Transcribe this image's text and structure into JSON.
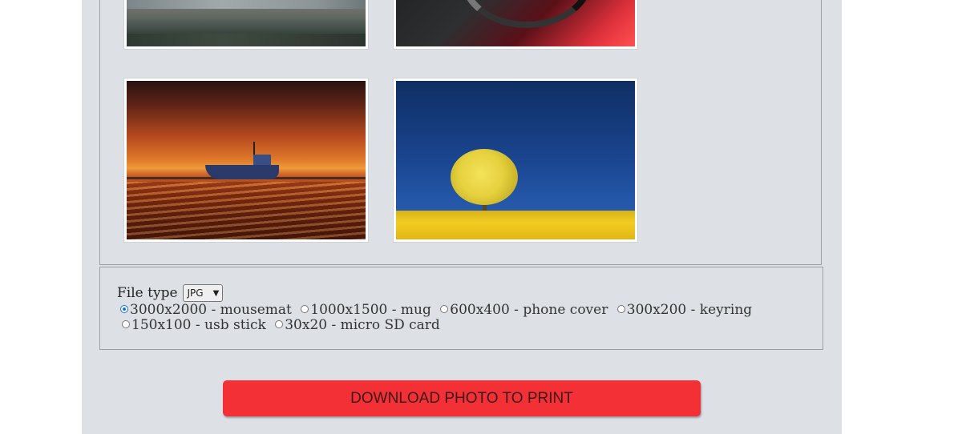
{
  "gallery": {
    "photos": [
      {
        "icon": "coast-photo"
      },
      {
        "icon": "red-car-photo"
      },
      {
        "icon": "boat-sunset-photo"
      },
      {
        "icon": "yellow-tree-photo"
      }
    ]
  },
  "options": {
    "file_type_label": "File type",
    "file_type_value": "JPG",
    "sizes": [
      {
        "label": "3000x2000 - mousemat",
        "checked": true
      },
      {
        "label": "1000x1500 - mug",
        "checked": false
      },
      {
        "label": "600x400 - phone cover",
        "checked": false
      },
      {
        "label": "300x200 - keyring",
        "checked": false
      },
      {
        "label": "150x100 - usb stick",
        "checked": false
      },
      {
        "label": "30x20 - micro SD card",
        "checked": false
      }
    ]
  },
  "download_button_label": "DOWNLOAD PHOTO TO PRINT",
  "colors": {
    "panel_bg": "#dde1e5",
    "button_bg": "#f33035",
    "radio_accent": "#1a73e8"
  }
}
